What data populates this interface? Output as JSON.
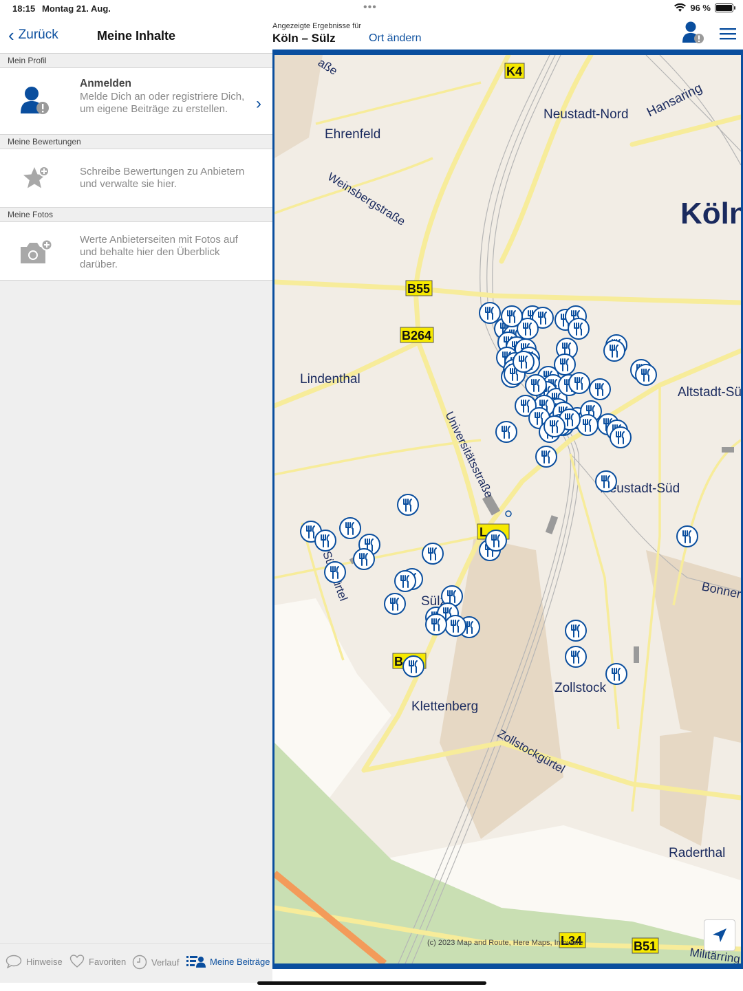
{
  "status": {
    "time": "18:15",
    "date": "Montag 21. Aug.",
    "battery": "96 %"
  },
  "left": {
    "back_label": "Zurück",
    "title": "Meine Inhalte",
    "sections": [
      {
        "header": "Mein Profil",
        "title": "Anmelden",
        "text": "Melde Dich an oder registriere Dich, um eigene Beiträge zu erstellen.",
        "icon": "user-alert-icon"
      },
      {
        "header": "Meine Bewertungen",
        "text": "Schreibe Bewertungen zu Anbietern und verwalte sie hier.",
        "icon": "star-add-icon"
      },
      {
        "header": "Meine Fotos",
        "text": "Werte Anbieterseiten mit Fotos auf und behalte hier den Überblick darüber.",
        "icon": "camera-add-icon"
      }
    ]
  },
  "tabs": [
    {
      "label": "Hinweise",
      "icon": "speech-bubble-icon",
      "active": false
    },
    {
      "label": "Favoriten",
      "icon": "heart-icon",
      "active": false
    },
    {
      "label": "Verlauf",
      "icon": "clock-icon",
      "active": false
    },
    {
      "label": "Meine Beiträge",
      "icon": "user-list-icon",
      "active": true
    }
  ],
  "map_header": {
    "subtitle": "Angezeigte Ergebnisse für",
    "location": "Köln – Sülz",
    "change_label": "Ort ändern"
  },
  "map": {
    "labels": [
      "Neustadt-Nord",
      "Hansaring",
      "Ehrenfeld",
      "Weinsbergstraße",
      "Köln",
      "Lindenthal",
      "Altstadt-Sü",
      "Universitätsstraße",
      "Neustadt-Süd",
      "Bonner",
      "Sülz",
      "Zollstock",
      "Klettenberg",
      "Zollstockgürtel",
      "Raderthal",
      "Militärring",
      "aße",
      "Sülzgürtel"
    ],
    "road_badges": [
      "K4",
      "B55",
      "B264",
      "L",
      "B",
      "L34",
      "B51"
    ],
    "copyright": "(c) 2023 Map and Route, Here Maps, Infoware",
    "colors": {
      "marker": "#0a4e9e",
      "road": "#f7ec9a",
      "land": "#f2ede5",
      "park": "#c9dfb3"
    }
  }
}
